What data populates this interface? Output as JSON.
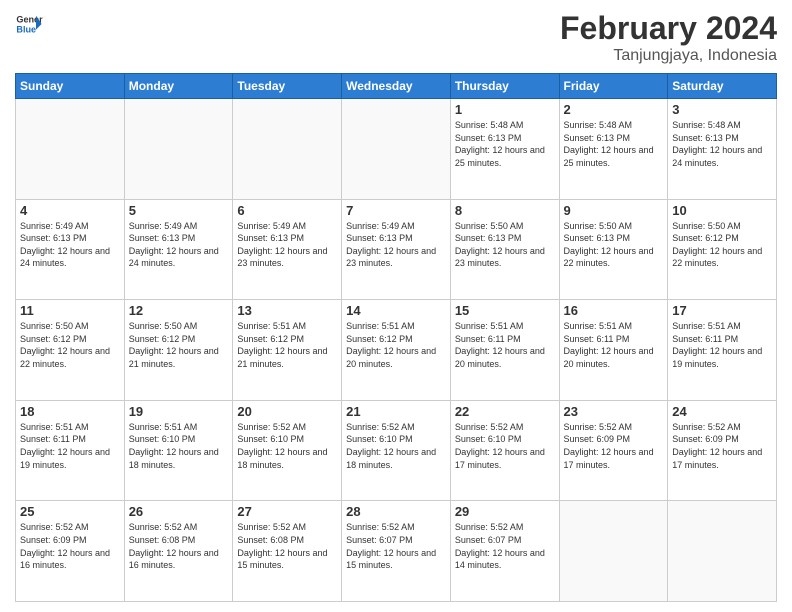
{
  "header": {
    "logo_general": "General",
    "logo_blue": "Blue",
    "main_title": "February 2024",
    "subtitle": "Tanjungjaya, Indonesia"
  },
  "days_of_week": [
    "Sunday",
    "Monday",
    "Tuesday",
    "Wednesday",
    "Thursday",
    "Friday",
    "Saturday"
  ],
  "weeks": [
    [
      {
        "day": "",
        "info": ""
      },
      {
        "day": "",
        "info": ""
      },
      {
        "day": "",
        "info": ""
      },
      {
        "day": "",
        "info": ""
      },
      {
        "day": "1",
        "info": "Sunrise: 5:48 AM\nSunset: 6:13 PM\nDaylight: 12 hours\nand 25 minutes."
      },
      {
        "day": "2",
        "info": "Sunrise: 5:48 AM\nSunset: 6:13 PM\nDaylight: 12 hours\nand 25 minutes."
      },
      {
        "day": "3",
        "info": "Sunrise: 5:48 AM\nSunset: 6:13 PM\nDaylight: 12 hours\nand 24 minutes."
      }
    ],
    [
      {
        "day": "4",
        "info": "Sunrise: 5:49 AM\nSunset: 6:13 PM\nDaylight: 12 hours\nand 24 minutes."
      },
      {
        "day": "5",
        "info": "Sunrise: 5:49 AM\nSunset: 6:13 PM\nDaylight: 12 hours\nand 24 minutes."
      },
      {
        "day": "6",
        "info": "Sunrise: 5:49 AM\nSunset: 6:13 PM\nDaylight: 12 hours\nand 23 minutes."
      },
      {
        "day": "7",
        "info": "Sunrise: 5:49 AM\nSunset: 6:13 PM\nDaylight: 12 hours\nand 23 minutes."
      },
      {
        "day": "8",
        "info": "Sunrise: 5:50 AM\nSunset: 6:13 PM\nDaylight: 12 hours\nand 23 minutes."
      },
      {
        "day": "9",
        "info": "Sunrise: 5:50 AM\nSunset: 6:13 PM\nDaylight: 12 hours\nand 22 minutes."
      },
      {
        "day": "10",
        "info": "Sunrise: 5:50 AM\nSunset: 6:12 PM\nDaylight: 12 hours\nand 22 minutes."
      }
    ],
    [
      {
        "day": "11",
        "info": "Sunrise: 5:50 AM\nSunset: 6:12 PM\nDaylight: 12 hours\nand 22 minutes."
      },
      {
        "day": "12",
        "info": "Sunrise: 5:50 AM\nSunset: 6:12 PM\nDaylight: 12 hours\nand 21 minutes."
      },
      {
        "day": "13",
        "info": "Sunrise: 5:51 AM\nSunset: 6:12 PM\nDaylight: 12 hours\nand 21 minutes."
      },
      {
        "day": "14",
        "info": "Sunrise: 5:51 AM\nSunset: 6:12 PM\nDaylight: 12 hours\nand 20 minutes."
      },
      {
        "day": "15",
        "info": "Sunrise: 5:51 AM\nSunset: 6:11 PM\nDaylight: 12 hours\nand 20 minutes."
      },
      {
        "day": "16",
        "info": "Sunrise: 5:51 AM\nSunset: 6:11 PM\nDaylight: 12 hours\nand 20 minutes."
      },
      {
        "day": "17",
        "info": "Sunrise: 5:51 AM\nSunset: 6:11 PM\nDaylight: 12 hours\nand 19 minutes."
      }
    ],
    [
      {
        "day": "18",
        "info": "Sunrise: 5:51 AM\nSunset: 6:11 PM\nDaylight: 12 hours\nand 19 minutes."
      },
      {
        "day": "19",
        "info": "Sunrise: 5:51 AM\nSunset: 6:10 PM\nDaylight: 12 hours\nand 18 minutes."
      },
      {
        "day": "20",
        "info": "Sunrise: 5:52 AM\nSunset: 6:10 PM\nDaylight: 12 hours\nand 18 minutes."
      },
      {
        "day": "21",
        "info": "Sunrise: 5:52 AM\nSunset: 6:10 PM\nDaylight: 12 hours\nand 18 minutes."
      },
      {
        "day": "22",
        "info": "Sunrise: 5:52 AM\nSunset: 6:10 PM\nDaylight: 12 hours\nand 17 minutes."
      },
      {
        "day": "23",
        "info": "Sunrise: 5:52 AM\nSunset: 6:09 PM\nDaylight: 12 hours\nand 17 minutes."
      },
      {
        "day": "24",
        "info": "Sunrise: 5:52 AM\nSunset: 6:09 PM\nDaylight: 12 hours\nand 17 minutes."
      }
    ],
    [
      {
        "day": "25",
        "info": "Sunrise: 5:52 AM\nSunset: 6:09 PM\nDaylight: 12 hours\nand 16 minutes."
      },
      {
        "day": "26",
        "info": "Sunrise: 5:52 AM\nSunset: 6:08 PM\nDaylight: 12 hours\nand 16 minutes."
      },
      {
        "day": "27",
        "info": "Sunrise: 5:52 AM\nSunset: 6:08 PM\nDaylight: 12 hours\nand 15 minutes."
      },
      {
        "day": "28",
        "info": "Sunrise: 5:52 AM\nSunset: 6:07 PM\nDaylight: 12 hours\nand 15 minutes."
      },
      {
        "day": "29",
        "info": "Sunrise: 5:52 AM\nSunset: 6:07 PM\nDaylight: 12 hours\nand 14 minutes."
      },
      {
        "day": "",
        "info": ""
      },
      {
        "day": "",
        "info": ""
      }
    ]
  ]
}
